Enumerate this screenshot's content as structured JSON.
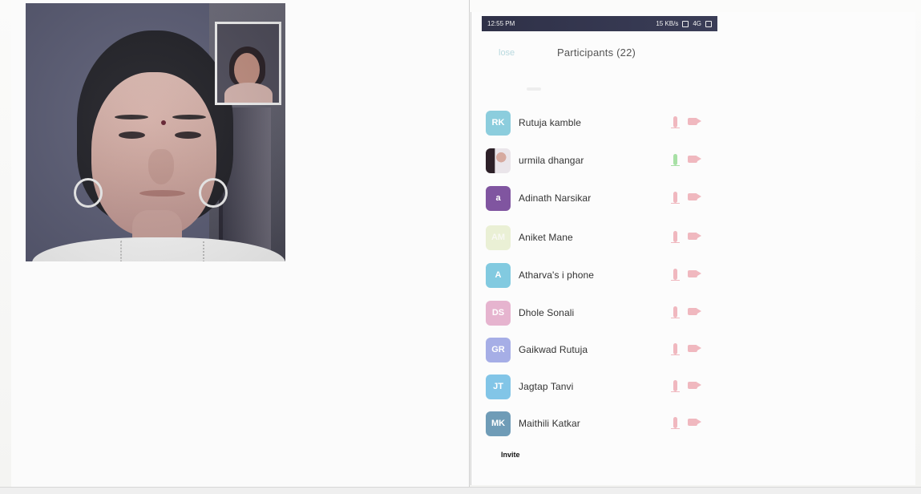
{
  "status_bar": {
    "time": "12:55 PM",
    "indicators": "15 KB/s",
    "signal": "4G"
  },
  "header": {
    "close_label": "lose",
    "title": "Participants (22)"
  },
  "participants": [
    {
      "initials": "RK",
      "name": "Rutuja kamble",
      "avatar_color": "#8ccddd",
      "mic_status": "muted",
      "mic_color": "#f0b8bf"
    },
    {
      "initials": "",
      "name": "urmila dhangar",
      "avatar_color": "#6f4b4e",
      "mic_status": "active",
      "mic_color": "#a7e0a5"
    },
    {
      "initials": "a",
      "name": "Adinath Narsikar",
      "avatar_color": "#8055a0",
      "mic_status": "muted",
      "mic_color": "#f0b8bf"
    },
    {
      "initials": "AM",
      "name": "Aniket Mane",
      "avatar_color": "#eaf0d5",
      "mic_status": "muted",
      "mic_color": "#f0b8bf"
    },
    {
      "initials": "A",
      "name": "Atharva's i phone",
      "avatar_color": "#82cae0",
      "mic_status": "muted",
      "mic_color": "#f0b8bf"
    },
    {
      "initials": "DS",
      "name": "Dhole Sonali",
      "avatar_color": "#e6b4cf",
      "mic_status": "muted",
      "mic_color": "#f0b8bf"
    },
    {
      "initials": "GR",
      "name": "Gaikwad Rutuja",
      "avatar_color": "#a6aee6",
      "mic_status": "muted",
      "mic_color": "#f0b8bf"
    },
    {
      "initials": "JT",
      "name": "Jagtap Tanvi",
      "avatar_color": "#82c5e7",
      "mic_status": "muted",
      "mic_color": "#f0b8bf"
    },
    {
      "initials": "MK",
      "name": "Maithili Katkar",
      "avatar_color": "#6f9cb7",
      "mic_status": "muted",
      "mic_color": "#f0b8bf"
    }
  ],
  "footer": {
    "invite_label": "Invite"
  }
}
